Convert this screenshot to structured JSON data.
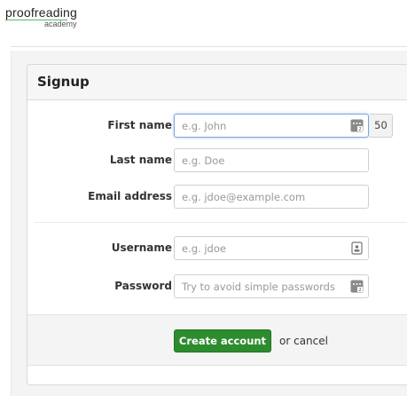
{
  "brand": {
    "name": "proofreading",
    "sub": "academy"
  },
  "form": {
    "title": "Signup",
    "fields": [
      {
        "label": "First name",
        "placeholder": "e.g. John",
        "icon": "password-manager-icon",
        "counter": "50"
      },
      {
        "label": "Last name",
        "placeholder": "e.g. Doe"
      },
      {
        "label": "Email address",
        "placeholder": "e.g. jdoe@example.com"
      },
      {
        "label": "Username",
        "placeholder": "e.g. jdoe",
        "icon": "contact-card-icon"
      },
      {
        "label": "Password",
        "placeholder": "Try to avoid simple passwords",
        "icon": "password-manager-icon"
      }
    ],
    "submit_label": "Create account",
    "or_text": "or",
    "cancel_label": "cancel"
  },
  "colors": {
    "accent": "#2d8c2e",
    "focus": "#7fa6d8",
    "logo_line": "#5ab66b"
  }
}
